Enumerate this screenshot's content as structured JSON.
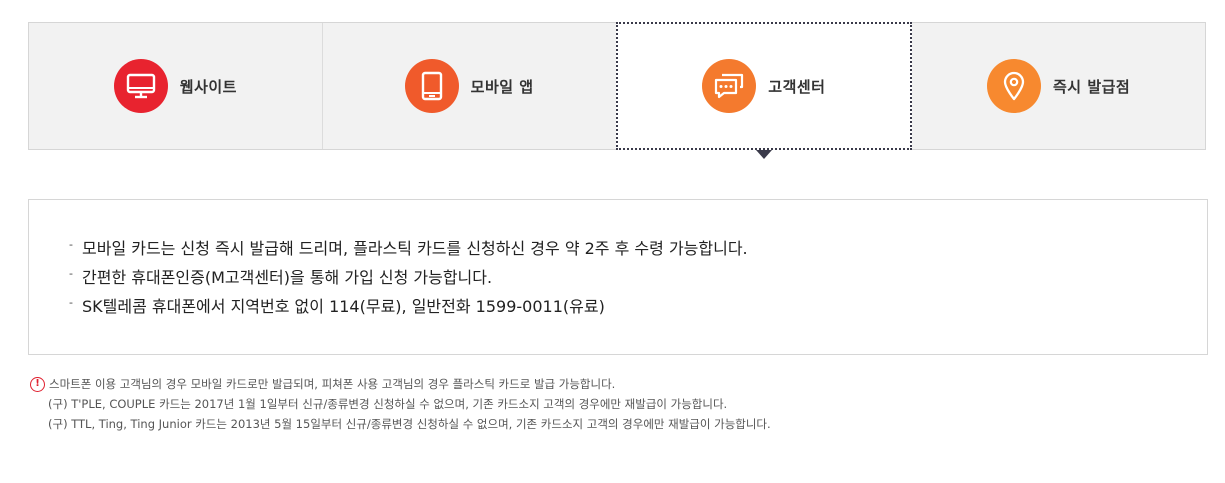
{
  "tabs": [
    {
      "label": "웹사이트",
      "icon": "monitor-icon",
      "color": "#e8232f",
      "active": false
    },
    {
      "label": "모바일 앱",
      "icon": "smartphone-icon",
      "color": "#f05a2b",
      "active": false
    },
    {
      "label": "고객센터",
      "icon": "chat-bubbles-icon",
      "color": "#f47a2e",
      "active": true
    },
    {
      "label": "즉시 발급점",
      "icon": "map-pin-icon",
      "color": "#f7892f",
      "active": false
    }
  ],
  "info": {
    "items": [
      "모바일 카드는 신청 즉시 발급해 드리며, 플라스틱 카드를 신청하신 경우 약 2주 후 수령 가능합니다.",
      "간편한 휴대폰인증(M고객센터)을 통해 가입 신청 가능합니다.",
      "SK텔레콤 휴대폰에서 지역번호 없이 114(무료), 일반전화 1599-0011(유료)"
    ]
  },
  "notes": {
    "icon": "exclamation-circle-icon",
    "main": "스마트폰 이용 고객님의 경우 모바일 카드로만 발급되며, 피쳐폰 사용 고객님의 경우 플라스틱 카드로 발급 가능합니다.",
    "sub": [
      "(구) T'PLE, COUPLE 카드는 2017년 1월 1일부터 신규/종류변경 신청하실 수 없으며, 기존 카드소지 고객의 경우에만 재발급이 가능합니다.",
      "(구) TTL, Ting, Ting Junior 카드는 2013년 5월 15일부터 신규/종류변경 신청하실 수 없으며, 기존 카드소지 고객의 경우에만 재발급이 가능합니다."
    ]
  }
}
